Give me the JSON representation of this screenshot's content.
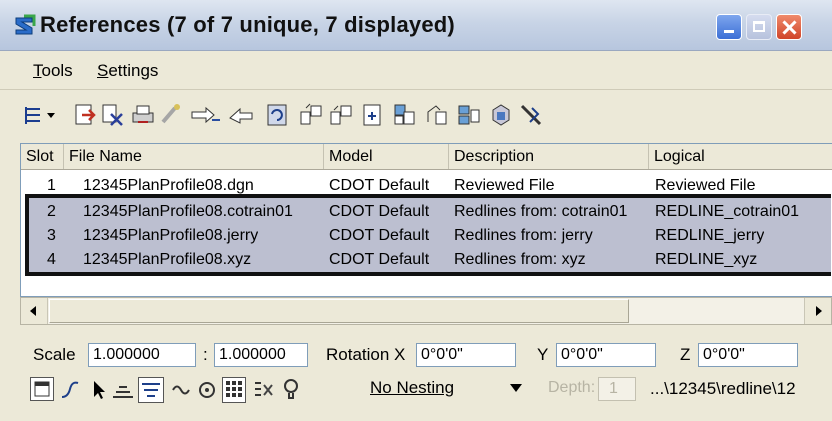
{
  "window": {
    "title": "References (7 of 7 unique, 7 displayed)",
    "app_icon": "microstation-icon",
    "controls": [
      "minimize-icon",
      "maximize-icon",
      "close-icon"
    ]
  },
  "menu": {
    "items": [
      {
        "label": "Tools"
      },
      {
        "label": "Settings"
      }
    ]
  },
  "toolbar": {
    "icons": [
      "list-view-icon",
      "attach-reference-icon",
      "detach-icon",
      "print-icon",
      "reload-icon",
      "move-icon",
      "copy-icon",
      "rotate-icon",
      "scale-icon",
      "mirror-horizontal-icon",
      "clip-boundary-icon",
      "clip-mask-icon",
      "clip-delete-icon",
      "merge-icon",
      "exchange-icon",
      "settings-icon"
    ]
  },
  "table": {
    "columns": [
      "Slot",
      "File Name",
      "Model",
      "Description",
      "Logical"
    ],
    "rows": [
      {
        "slot": "1",
        "file": "12345PlanProfile08.dgn",
        "model": "CDOT Default",
        "description": "Reviewed File",
        "logical": "Reviewed File"
      },
      {
        "slot": "2",
        "file": "12345PlanProfile08.cotrain01",
        "model": "CDOT Default",
        "description": "Redlines from: cotrain01",
        "logical": "REDLINE_cotrain01"
      },
      {
        "slot": "3",
        "file": "12345PlanProfile08.jerry",
        "model": "CDOT Default",
        "description": "Redlines from: jerry",
        "logical": "REDLINE_jerry"
      },
      {
        "slot": "4",
        "file": "12345PlanProfile08.xyz",
        "model": "CDOT Default",
        "description": "Redlines from: xyz",
        "logical": "REDLINE_xyz"
      }
    ]
  },
  "settings": {
    "scale_label": "Scale",
    "scale_a": "1.000000",
    "scale_sep": ":",
    "scale_b": "1.000000",
    "rotation_label": "Rotation X",
    "rotation_x": "0°0'0\"",
    "y_label": "Y",
    "rotation_y": "0°0'0\"",
    "z_label": "Z",
    "rotation_z": "0°0'0\""
  },
  "bottom": {
    "icons": [
      "display-icon",
      "snap-icon",
      "locate-icon",
      "level-display-icon",
      "hilite-icon",
      "treat-as-element-icon",
      "scale-line-styles-icon",
      "raster-icon",
      "level-override-icon",
      "hint-icon"
    ],
    "nesting": "No Nesting",
    "depth_label": "Depth:",
    "depth_value": "1",
    "path": "...\\12345\\redline\\12"
  },
  "colors": {
    "highlight": "#bcbfd0",
    "title_gradient": "#c8d4e6",
    "face": "#ece9d8"
  }
}
